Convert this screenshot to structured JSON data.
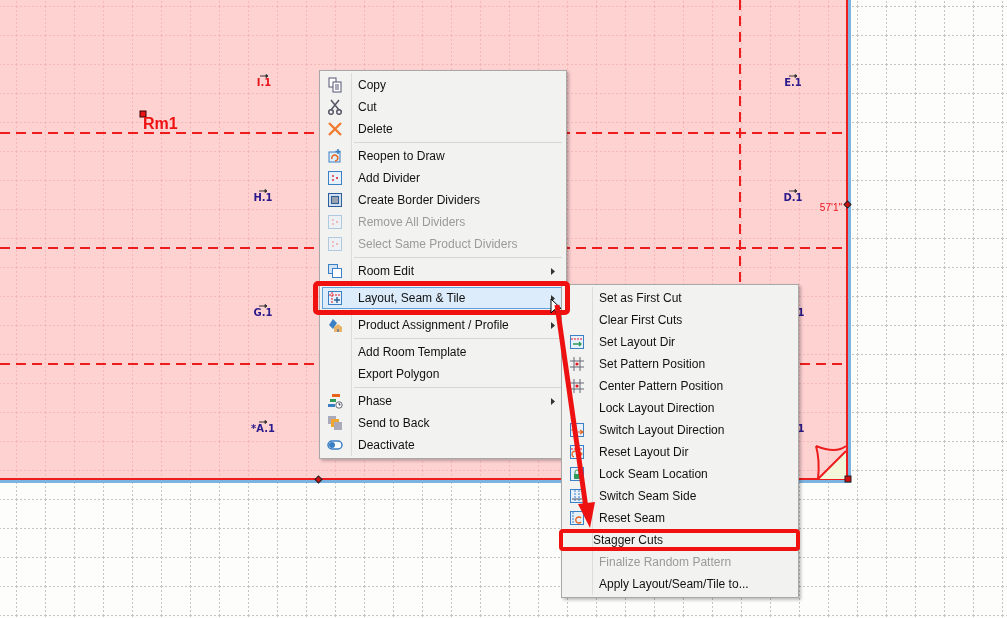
{
  "canvas": {
    "room_name": "Rm1",
    "dimension": "57'1\"",
    "labels": [
      {
        "text": "I.1",
        "color": "#e8141c"
      },
      {
        "text": "E.1",
        "color": "#2a1a8c"
      },
      {
        "text": "H.1",
        "color": "#2a1a8c"
      },
      {
        "text": "D.1",
        "color": "#2a1a8c"
      },
      {
        "text": "G.1",
        "color": "#2a1a8c"
      },
      {
        "text": "1",
        "color": "#2a1a8c"
      },
      {
        "text": "*A.1",
        "color": "#2a1a8c"
      },
      {
        "text": "1",
        "color": "#2a1a8c"
      }
    ]
  },
  "context_menu": {
    "groups": [
      [
        {
          "label": "Copy",
          "kind": "copy",
          "disabled": false,
          "has_submenu": false,
          "selected": false,
          "annotated": false
        },
        {
          "label": "Cut",
          "kind": "cut",
          "disabled": false,
          "has_submenu": false,
          "selected": false,
          "annotated": false
        },
        {
          "label": "Delete",
          "kind": "delete",
          "disabled": false,
          "has_submenu": false,
          "selected": false,
          "annotated": false
        }
      ],
      [
        {
          "label": "Reopen to Draw",
          "kind": "reopen",
          "disabled": false,
          "has_submenu": false,
          "selected": false,
          "annotated": false
        },
        {
          "label": "Add Divider",
          "kind": "divider",
          "disabled": false,
          "has_submenu": false,
          "selected": false,
          "annotated": false
        },
        {
          "label": "Create Border Dividers",
          "kind": "border",
          "disabled": false,
          "has_submenu": false,
          "selected": false,
          "annotated": false
        },
        {
          "label": "Remove All Dividers",
          "kind": "divider",
          "disabled": true,
          "has_submenu": false,
          "selected": false,
          "annotated": false
        },
        {
          "label": "Select Same Product Dividers",
          "kind": "divider",
          "disabled": true,
          "has_submenu": false,
          "selected": false,
          "annotated": false
        }
      ],
      [
        {
          "label": "Room Edit",
          "kind": "room_edit",
          "disabled": false,
          "has_submenu": true,
          "selected": false,
          "annotated": false
        }
      ],
      [
        {
          "label": "Layout, Seam & Tile",
          "kind": "layout",
          "disabled": false,
          "has_submenu": true,
          "selected": true,
          "annotated": true
        }
      ],
      [
        {
          "label": "Product Assignment / Profile",
          "kind": "product",
          "disabled": false,
          "has_submenu": true,
          "selected": false,
          "annotated": false
        }
      ],
      [
        {
          "label": "Add Room Template",
          "kind": "plain",
          "disabled": false,
          "has_submenu": false,
          "selected": false,
          "annotated": false
        },
        {
          "label": "Export Polygon",
          "kind": "plain",
          "disabled": false,
          "has_submenu": false,
          "selected": false,
          "annotated": false
        }
      ],
      [
        {
          "label": "Phase",
          "kind": "phase",
          "disabled": false,
          "has_submenu": true,
          "selected": false,
          "annotated": false
        },
        {
          "label": "Send to Back",
          "kind": "send_back",
          "disabled": false,
          "has_submenu": false,
          "selected": false,
          "annotated": false
        },
        {
          "label": "Deactivate",
          "kind": "toggle",
          "disabled": false,
          "has_submenu": false,
          "selected": false,
          "annotated": false
        }
      ]
    ]
  },
  "submenu": {
    "items": [
      {
        "label": "Set as First Cut",
        "kind": "plain",
        "disabled": false,
        "annotated": false
      },
      {
        "label": "Clear First Cuts",
        "kind": "plain",
        "disabled": false,
        "annotated": false
      },
      {
        "label": "Set Layout Dir",
        "kind": "layout_dir",
        "disabled": false,
        "annotated": false
      },
      {
        "label": "Set Pattern Position",
        "kind": "grid_dot",
        "disabled": false,
        "annotated": false
      },
      {
        "label": "Center Pattern Position",
        "kind": "grid_dot",
        "disabled": false,
        "annotated": false
      },
      {
        "label": "Lock Layout Direction",
        "kind": "plain",
        "disabled": false,
        "annotated": false
      },
      {
        "label": "Switch Layout Direction",
        "kind": "layout_swap",
        "disabled": false,
        "annotated": false
      },
      {
        "label": "Reset Layout Dir",
        "kind": "layout_reset",
        "disabled": false,
        "annotated": false
      },
      {
        "label": "Lock Seam Location",
        "kind": "lock",
        "disabled": false,
        "annotated": false
      },
      {
        "label": "Switch Seam Side",
        "kind": "seam_swap",
        "disabled": false,
        "annotated": false
      },
      {
        "label": "Reset Seam",
        "kind": "seam_reset",
        "disabled": false,
        "annotated": false
      },
      {
        "label": "Stagger Cuts",
        "kind": "plain",
        "disabled": false,
        "annotated": true
      },
      {
        "label": "Finalize Random Pattern",
        "kind": "plain",
        "disabled": true,
        "annotated": false
      },
      {
        "label": "Apply Layout/Seam/Tile to...",
        "kind": "plain",
        "disabled": false,
        "annotated": false
      }
    ]
  }
}
